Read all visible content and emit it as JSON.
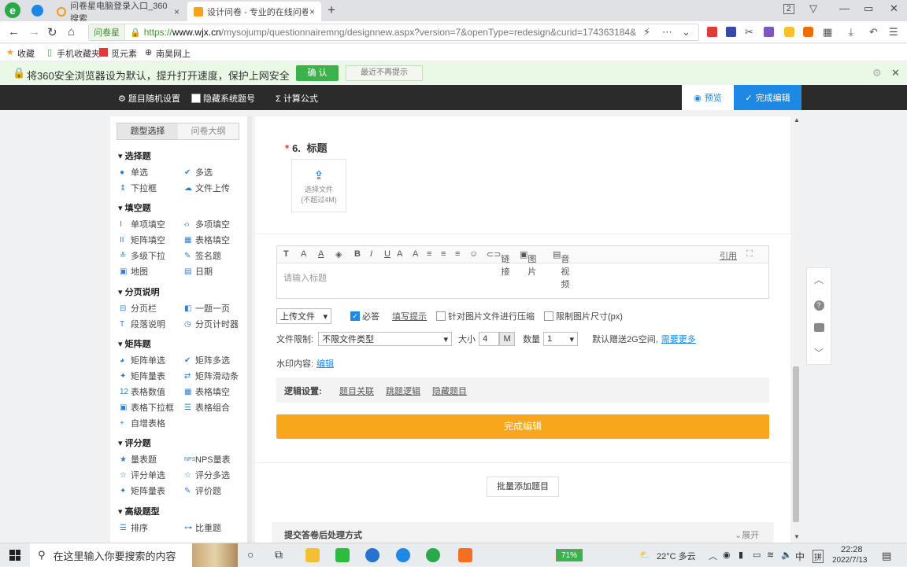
{
  "browser": {
    "tabs": [
      {
        "title": "问卷星电脑登录入口_360搜索",
        "close": "×"
      },
      {
        "title": "设计问卷 - 专业的在线问卷",
        "close": "×"
      }
    ],
    "new_tab": "+",
    "badge": "2",
    "url": {
      "site": "问卷星",
      "scheme": "https://",
      "domain": "www.wjx.cn",
      "path": "/mysojump/questionnairemng/designnew.aspx?version=7&openType=redesign&curid=174363184&"
    },
    "bookmarks": [
      "收藏",
      "手机收藏夹",
      "觅元素",
      "南昊网上"
    ]
  },
  "notice": {
    "text": "将360安全浏览器设为默认，提升打开速度，保护上网安全",
    "confirm": "确 认",
    "later": "最近不再提示"
  },
  "topbar": {
    "random": "题目随机设置",
    "hide_no": "隐藏系统题号",
    "formula": "计算公式",
    "preview": "预览",
    "done": "完成编辑"
  },
  "left": {
    "tabs": [
      "题型选择",
      "问卷大纲"
    ],
    "sections": [
      {
        "title": "选择题",
        "items": [
          "单选",
          "多选",
          "下拉框",
          "文件上传"
        ]
      },
      {
        "title": "填空题",
        "items": [
          "单项填空",
          "多项填空",
          "矩阵填空",
          "表格填空",
          "多级下拉",
          "签名题",
          "地图",
          "日期"
        ]
      },
      {
        "title": "分页说明",
        "items": [
          "分页栏",
          "一题一页",
          "段落说明",
          "分页计时器"
        ]
      },
      {
        "title": "矩阵题",
        "items": [
          "矩阵单选",
          "矩阵多选",
          "矩阵量表",
          "矩阵滑动条",
          "表格数值",
          "表格填空",
          "表格下拉框",
          "表格组合",
          "自增表格"
        ]
      },
      {
        "title": "评分题",
        "items": [
          "量表题",
          "NPS量表",
          "评分单选",
          "评分多选",
          "矩阵量表",
          "评价题"
        ]
      },
      {
        "title": "高级题型",
        "items": [
          "排序",
          "比重题"
        ]
      }
    ]
  },
  "question": {
    "number": "6.",
    "title": "标题",
    "upload_line1": "选择文件",
    "upload_line2": "(不超过4M)",
    "editor_tools": [
      "T",
      "A",
      "A",
      "B",
      "I",
      "U",
      "A",
      "A",
      "链接",
      "图片",
      "音视频"
    ],
    "quote": "引用",
    "placeholder": "请输入标题",
    "type_select": "上传文件",
    "required": "必答",
    "hint": "填写提示",
    "compress": "针对图片文件进行压缩",
    "limit_size": "限制图片尺寸(px)",
    "file_limit_label": "文件限制:",
    "file_type": "不限文件类型",
    "size_label": "大小",
    "size_value": "4",
    "size_unit": "M",
    "count_label": "数量",
    "count_value": "1",
    "gift": "默认赠送2G空间,",
    "more": "需要更多",
    "watermark_label": "水印内容:",
    "watermark_edit": "编辑",
    "logic_label": "逻辑设置:",
    "logic_links": [
      "题目关联",
      "跳题逻辑",
      "隐藏题目"
    ],
    "finish": "完成编辑",
    "batch": "批量添加题目",
    "submit_title": "提交答卷后处理方式",
    "expand": "展开"
  },
  "taskbar": {
    "search": "在这里输入你要搜索的内容",
    "battery": "71%",
    "weather": "22°C 多云",
    "ime": "中",
    "ime2": "拼",
    "time": "22:28",
    "date": "2022/7/13"
  }
}
